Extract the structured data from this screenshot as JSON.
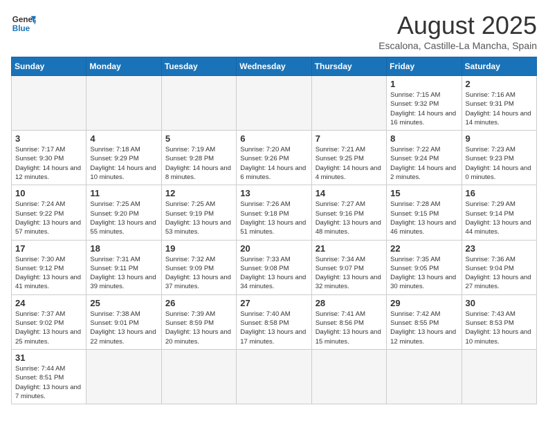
{
  "header": {
    "logo_general": "General",
    "logo_blue": "Blue",
    "month_title": "August 2025",
    "subtitle": "Escalona, Castille-La Mancha, Spain"
  },
  "weekdays": [
    "Sunday",
    "Monday",
    "Tuesday",
    "Wednesday",
    "Thursday",
    "Friday",
    "Saturday"
  ],
  "weeks": [
    [
      {
        "day": "",
        "info": ""
      },
      {
        "day": "",
        "info": ""
      },
      {
        "day": "",
        "info": ""
      },
      {
        "day": "",
        "info": ""
      },
      {
        "day": "",
        "info": ""
      },
      {
        "day": "1",
        "info": "Sunrise: 7:15 AM\nSunset: 9:32 PM\nDaylight: 14 hours and 16 minutes."
      },
      {
        "day": "2",
        "info": "Sunrise: 7:16 AM\nSunset: 9:31 PM\nDaylight: 14 hours and 14 minutes."
      }
    ],
    [
      {
        "day": "3",
        "info": "Sunrise: 7:17 AM\nSunset: 9:30 PM\nDaylight: 14 hours and 12 minutes."
      },
      {
        "day": "4",
        "info": "Sunrise: 7:18 AM\nSunset: 9:29 PM\nDaylight: 14 hours and 10 minutes."
      },
      {
        "day": "5",
        "info": "Sunrise: 7:19 AM\nSunset: 9:28 PM\nDaylight: 14 hours and 8 minutes."
      },
      {
        "day": "6",
        "info": "Sunrise: 7:20 AM\nSunset: 9:26 PM\nDaylight: 14 hours and 6 minutes."
      },
      {
        "day": "7",
        "info": "Sunrise: 7:21 AM\nSunset: 9:25 PM\nDaylight: 14 hours and 4 minutes."
      },
      {
        "day": "8",
        "info": "Sunrise: 7:22 AM\nSunset: 9:24 PM\nDaylight: 14 hours and 2 minutes."
      },
      {
        "day": "9",
        "info": "Sunrise: 7:23 AM\nSunset: 9:23 PM\nDaylight: 14 hours and 0 minutes."
      }
    ],
    [
      {
        "day": "10",
        "info": "Sunrise: 7:24 AM\nSunset: 9:22 PM\nDaylight: 13 hours and 57 minutes."
      },
      {
        "day": "11",
        "info": "Sunrise: 7:25 AM\nSunset: 9:20 PM\nDaylight: 13 hours and 55 minutes."
      },
      {
        "day": "12",
        "info": "Sunrise: 7:25 AM\nSunset: 9:19 PM\nDaylight: 13 hours and 53 minutes."
      },
      {
        "day": "13",
        "info": "Sunrise: 7:26 AM\nSunset: 9:18 PM\nDaylight: 13 hours and 51 minutes."
      },
      {
        "day": "14",
        "info": "Sunrise: 7:27 AM\nSunset: 9:16 PM\nDaylight: 13 hours and 48 minutes."
      },
      {
        "day": "15",
        "info": "Sunrise: 7:28 AM\nSunset: 9:15 PM\nDaylight: 13 hours and 46 minutes."
      },
      {
        "day": "16",
        "info": "Sunrise: 7:29 AM\nSunset: 9:14 PM\nDaylight: 13 hours and 44 minutes."
      }
    ],
    [
      {
        "day": "17",
        "info": "Sunrise: 7:30 AM\nSunset: 9:12 PM\nDaylight: 13 hours and 41 minutes."
      },
      {
        "day": "18",
        "info": "Sunrise: 7:31 AM\nSunset: 9:11 PM\nDaylight: 13 hours and 39 minutes."
      },
      {
        "day": "19",
        "info": "Sunrise: 7:32 AM\nSunset: 9:09 PM\nDaylight: 13 hours and 37 minutes."
      },
      {
        "day": "20",
        "info": "Sunrise: 7:33 AM\nSunset: 9:08 PM\nDaylight: 13 hours and 34 minutes."
      },
      {
        "day": "21",
        "info": "Sunrise: 7:34 AM\nSunset: 9:07 PM\nDaylight: 13 hours and 32 minutes."
      },
      {
        "day": "22",
        "info": "Sunrise: 7:35 AM\nSunset: 9:05 PM\nDaylight: 13 hours and 30 minutes."
      },
      {
        "day": "23",
        "info": "Sunrise: 7:36 AM\nSunset: 9:04 PM\nDaylight: 13 hours and 27 minutes."
      }
    ],
    [
      {
        "day": "24",
        "info": "Sunrise: 7:37 AM\nSunset: 9:02 PM\nDaylight: 13 hours and 25 minutes."
      },
      {
        "day": "25",
        "info": "Sunrise: 7:38 AM\nSunset: 9:01 PM\nDaylight: 13 hours and 22 minutes."
      },
      {
        "day": "26",
        "info": "Sunrise: 7:39 AM\nSunset: 8:59 PM\nDaylight: 13 hours and 20 minutes."
      },
      {
        "day": "27",
        "info": "Sunrise: 7:40 AM\nSunset: 8:58 PM\nDaylight: 13 hours and 17 minutes."
      },
      {
        "day": "28",
        "info": "Sunrise: 7:41 AM\nSunset: 8:56 PM\nDaylight: 13 hours and 15 minutes."
      },
      {
        "day": "29",
        "info": "Sunrise: 7:42 AM\nSunset: 8:55 PM\nDaylight: 13 hours and 12 minutes."
      },
      {
        "day": "30",
        "info": "Sunrise: 7:43 AM\nSunset: 8:53 PM\nDaylight: 13 hours and 10 minutes."
      }
    ],
    [
      {
        "day": "31",
        "info": "Sunrise: 7:44 AM\nSunset: 8:51 PM\nDaylight: 13 hours and 7 minutes."
      },
      {
        "day": "",
        "info": ""
      },
      {
        "day": "",
        "info": ""
      },
      {
        "day": "",
        "info": ""
      },
      {
        "day": "",
        "info": ""
      },
      {
        "day": "",
        "info": ""
      },
      {
        "day": "",
        "info": ""
      }
    ]
  ]
}
